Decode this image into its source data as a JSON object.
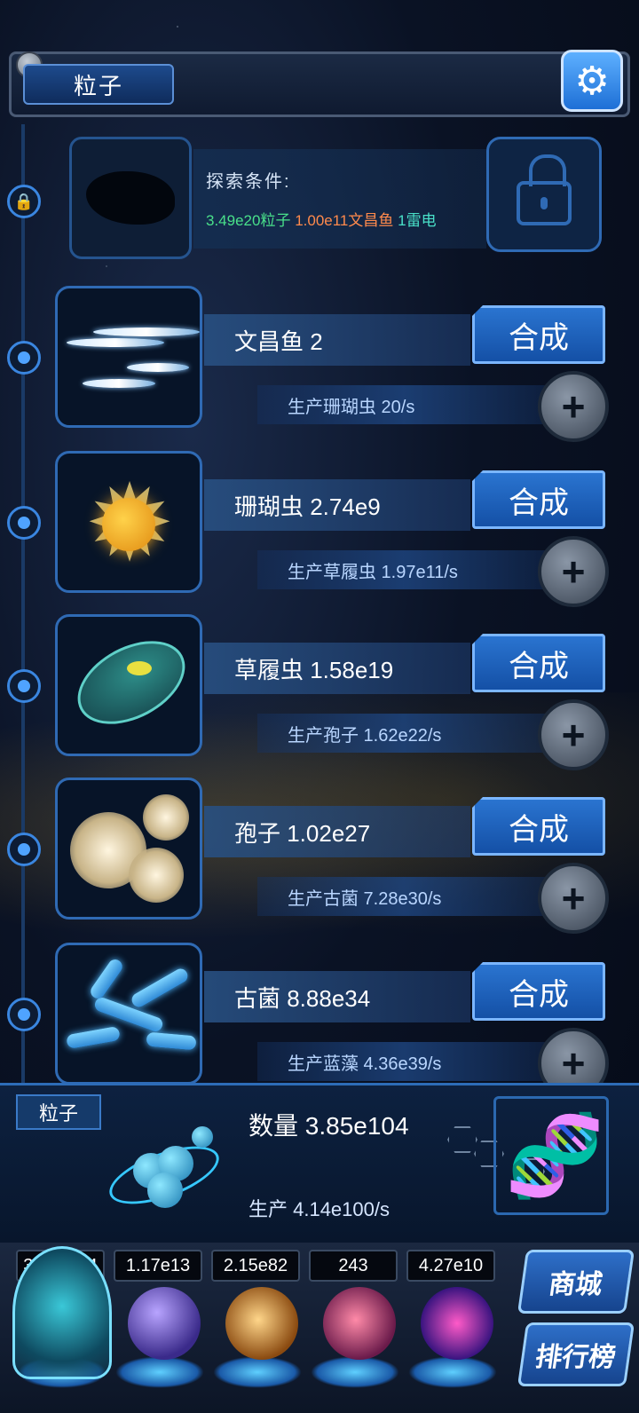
{
  "header": {
    "title": "粒子",
    "settings_icon": "gear-icon"
  },
  "locked": {
    "label": "探索条件:",
    "requirements": [
      {
        "text": "3.49e20粒子",
        "color": "#49e08a"
      },
      {
        "text": "1.00e11文昌鱼",
        "color": "#ff8a4c"
      },
      {
        "text": "1雷电",
        "color": "#49e0c8"
      }
    ],
    "lock_icon": "padlock-icon"
  },
  "rows": [
    {
      "name": "文昌鱼 2",
      "production": "生产珊瑚虫 20/s",
      "synth": "合成",
      "art": "lancelet"
    },
    {
      "name": "珊瑚虫 2.74e9",
      "production": "生产草履虫 1.97e11/s",
      "synth": "合成",
      "art": "coral-polyp"
    },
    {
      "name": "草履虫 1.58e19",
      "production": "生产孢子 1.62e22/s",
      "synth": "合成",
      "art": "paramecium"
    },
    {
      "name": "孢子 1.02e27",
      "production": "生产古菌 7.28e30/s",
      "synth": "合成",
      "art": "spore"
    },
    {
      "name": "古菌 8.88e34",
      "production": "生产蓝藻 4.36e39/s",
      "synth": "合成",
      "art": "archaea"
    }
  ],
  "panel": {
    "tag": "粒子",
    "count": "数量 3.85e104",
    "rate": "生产 4.14e100/s"
  },
  "resources": [
    {
      "value": "3.85e104",
      "orb": "particle"
    },
    {
      "value": "1.17e13",
      "orb": "lightning"
    },
    {
      "value": "2.15e82",
      "orb": "galaxy"
    },
    {
      "value": "243",
      "orb": "brain"
    },
    {
      "value": "4.27e10",
      "orb": "vortex"
    }
  ],
  "side_buttons": {
    "shop": "商城",
    "ranking": "排行榜"
  }
}
